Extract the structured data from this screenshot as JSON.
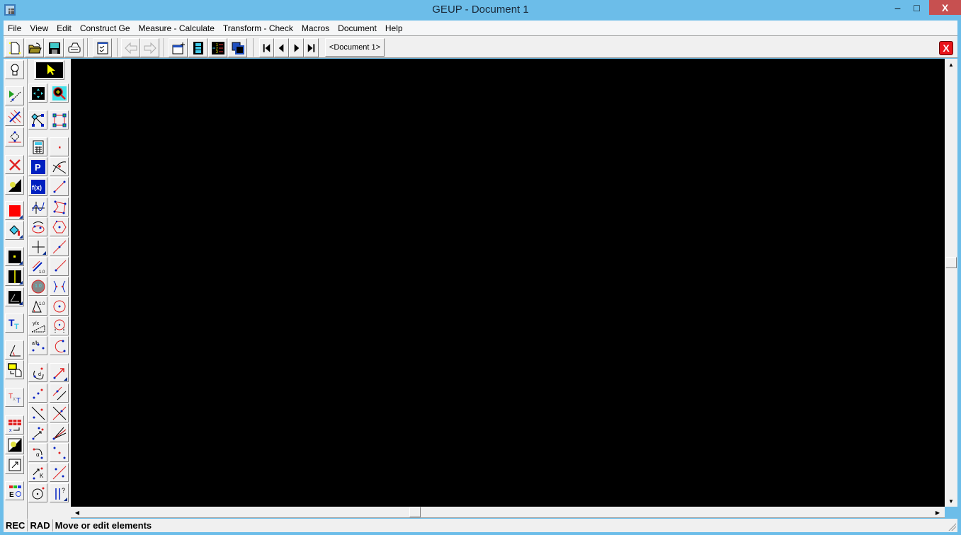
{
  "window": {
    "title": "GEUP - Document 1",
    "controls": {
      "minimize": "–",
      "maximize": "□",
      "close": "X"
    }
  },
  "menu": [
    {
      "label": "File"
    },
    {
      "label": "View"
    },
    {
      "label": "Edit"
    },
    {
      "label": "Construct Ge"
    },
    {
      "label": "Measure - Calculate"
    },
    {
      "label": "Transform - Check"
    },
    {
      "label": "Macros"
    },
    {
      "label": "Document"
    },
    {
      "label": "Help"
    }
  ],
  "toolbar": {
    "buttons": [
      "new-document",
      "open",
      "save",
      "print",
      "checklist",
      "back",
      "forward",
      "new-window",
      "film-animation",
      "numbered-list",
      "cascade-windows",
      "first",
      "previous",
      "next",
      "last"
    ],
    "document_tab": "<Document 1>",
    "close_document": "X"
  },
  "left_tools": {
    "column1": [
      "lightbulb-hint",
      "show-hide",
      "parallel-lines",
      "locus",
      "delete",
      "brightness",
      "color",
      "fill",
      "point-style",
      "line-style",
      "angle-style",
      "text-style",
      "angle-measure",
      "copy-paste-figure",
      "text-format",
      "table-insert",
      "brightness-2",
      "resize",
      "element-colors"
    ],
    "column2_wide": [
      "select-pointer"
    ],
    "column2": [
      "fit-view",
      "network",
      "calculator",
      "parameter",
      "function",
      "plot-function",
      "rotate-ellipse",
      "perpendicular-axes",
      "measure-length",
      "measure-area",
      "measure-angle",
      "ratio",
      "ratio-ab",
      "distance",
      "points-scatter",
      "line-through-points",
      "vector-translate",
      "rotate-alpha",
      "dilate-k",
      "circle-point"
    ],
    "column3": [
      "zoom",
      "grid-graph",
      "point",
      "intersection",
      "segment",
      "polygon",
      "regular-polygon",
      "line",
      "ray",
      "hyperbola",
      "circle",
      "circle-diameter",
      "arc",
      "vector",
      "parallel",
      "perpendicular",
      "bisector",
      "midpoint",
      "reflection",
      "check-parallel"
    ],
    "labels": {
      "parameter": "P",
      "function": "f(x)",
      "measure_length": "1.0",
      "ratio": "y/x",
      "element_colors": "EO",
      "check": "?"
    }
  },
  "status": {
    "mode1": "REC",
    "mode2": "RAD",
    "message": "Move or edit elements"
  },
  "colors": {
    "titlebar": "#6cbde9",
    "canvas": "#000000",
    "close_button": "#c75050",
    "panel": "#f0f0f0"
  }
}
